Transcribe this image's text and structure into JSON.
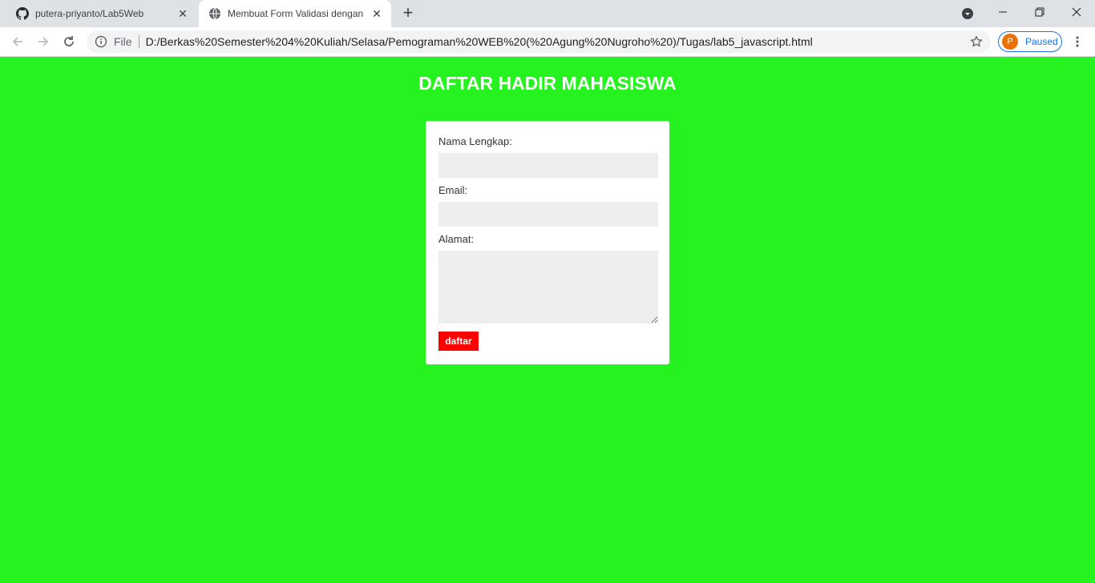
{
  "browser": {
    "tabs": [
      {
        "title": "putera-priyanto/Lab5Web",
        "icon": "github-icon",
        "active": false
      },
      {
        "title": "Membuat Form Validasi dengan J",
        "icon": "globe-icon",
        "active": true
      }
    ],
    "address_bar": {
      "scheme_label": "File",
      "url": "D:/Berkas%20Semester%204%20Kuliah/Selasa/Pemograman%20WEB%20(%20Agung%20Nugroho%20)/Tugas/lab5_javascript.html"
    },
    "profile": {
      "initial": "P",
      "status": "Paused"
    }
  },
  "page": {
    "background": "#25f21f",
    "title": "DAFTAR HADIR MAHASISWA",
    "form": {
      "name_label": "Nama Lengkap:",
      "name_value": "",
      "email_label": "Email:",
      "email_value": "",
      "address_label": "Alamat:",
      "address_value": "",
      "submit_label": "daftar",
      "submit_color": "#ff0000"
    }
  }
}
